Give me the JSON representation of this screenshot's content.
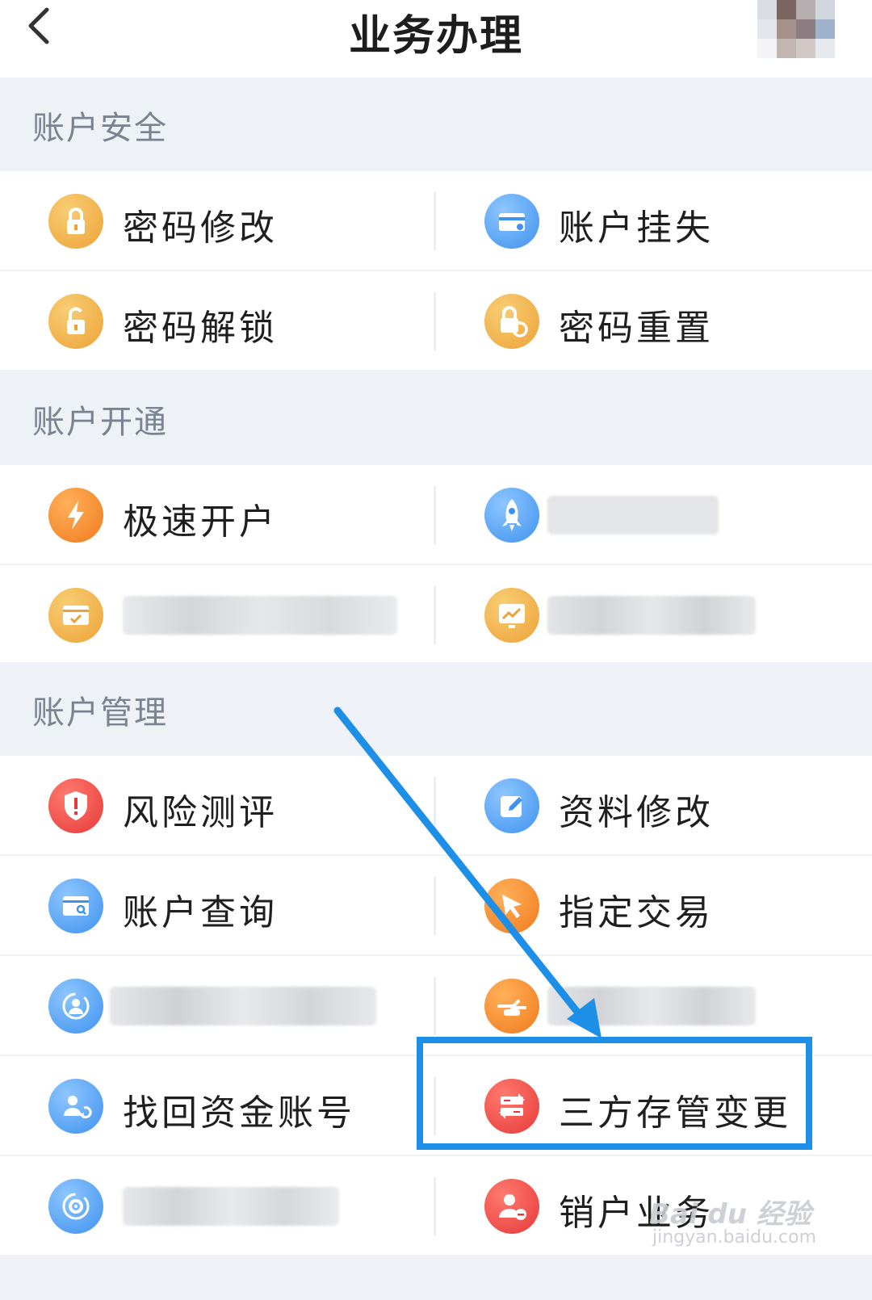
{
  "header": {
    "title": "业务办理"
  },
  "sections": [
    {
      "title": "账户安全",
      "rows": [
        {
          "left": {
            "label": "密码修改",
            "icon": "lock-icon"
          },
          "right": {
            "label": "账户挂失",
            "icon": "card-icon"
          }
        },
        {
          "left": {
            "label": "密码解锁",
            "icon": "unlock-icon"
          },
          "right": {
            "label": "密码重置",
            "icon": "lock-reset-icon"
          }
        }
      ]
    },
    {
      "title": "账户开通",
      "rows": [
        {
          "left": {
            "label": "极速开户",
            "icon": "lightning-icon"
          },
          "right": {
            "label": "",
            "icon": "rocket-icon"
          }
        },
        {
          "left": {
            "label": "",
            "icon": "card-check-icon"
          },
          "right": {
            "label": "",
            "icon": "chart-screen-icon"
          }
        }
      ]
    },
    {
      "title": "账户管理",
      "rows": [
        {
          "left": {
            "label": "风险测评",
            "icon": "shield-alert-icon"
          },
          "right": {
            "label": "资料修改",
            "icon": "edit-icon"
          }
        },
        {
          "left": {
            "label": "账户查询",
            "icon": "card-search-icon"
          },
          "right": {
            "label": "指定交易",
            "icon": "cursor-icon"
          }
        },
        {
          "left": {
            "label": "",
            "icon": "user-refresh-icon"
          },
          "right": {
            "label": "",
            "icon": "hand-exchange-icon"
          }
        },
        {
          "left": {
            "label": "找回资金账号",
            "icon": "user-return-icon"
          },
          "right": {
            "label": "三方存管变更",
            "icon": "transfer-icon"
          }
        },
        {
          "left": {
            "label": "",
            "icon": "gear-refresh-icon"
          },
          "right": {
            "label": "销户业务",
            "icon": "user-remove-icon"
          }
        }
      ]
    }
  ],
  "watermark": {
    "logo": "Bai du 经验",
    "url": "jingyan.baidu.com"
  },
  "colors": {
    "orange": "#eda238",
    "blue": "#3f92ee",
    "red": "#e63a3a",
    "highlight": "#1e8fe6"
  }
}
